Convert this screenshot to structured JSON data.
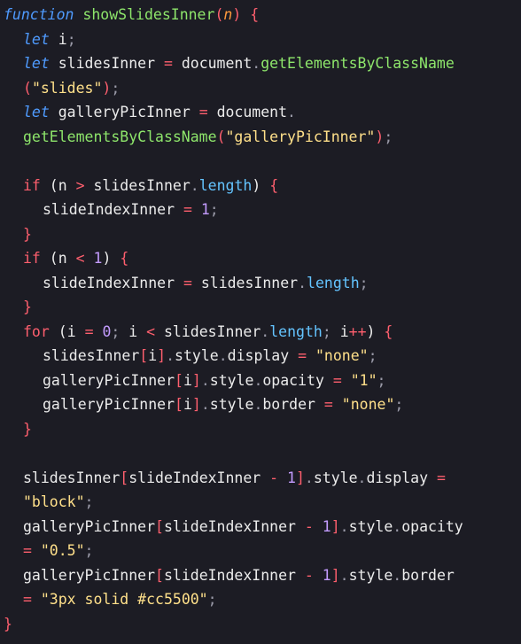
{
  "editor": {
    "lines": [
      {
        "indent": 0,
        "tokens": [
          {
            "t": "function",
            "c": "kw-italic"
          },
          {
            "t": " ",
            "c": "ident"
          },
          {
            "t": "showSlidesInner",
            "c": "fn"
          },
          {
            "t": "(",
            "c": "brace"
          },
          {
            "t": "n",
            "c": "param"
          },
          {
            "t": ")",
            "c": "brace"
          },
          {
            "t": " ",
            "c": "ident"
          },
          {
            "t": "{",
            "c": "brace"
          }
        ]
      },
      {
        "indent": 1,
        "tokens": [
          {
            "t": "let",
            "c": "kw-italic"
          },
          {
            "t": " i",
            "c": "ident"
          },
          {
            "t": ";",
            "c": "punc"
          }
        ]
      },
      {
        "indent": 1,
        "tokens": [
          {
            "t": "let",
            "c": "kw-italic"
          },
          {
            "t": " slidesInner ",
            "c": "ident"
          },
          {
            "t": "=",
            "c": "op"
          },
          {
            "t": " document",
            "c": "ident"
          },
          {
            "t": ".",
            "c": "punc"
          },
          {
            "t": "getElementsByClassName",
            "c": "fn"
          }
        ]
      },
      {
        "indent": 1,
        "tokens": [
          {
            "t": "(",
            "c": "brace"
          },
          {
            "t": "\"slides\"",
            "c": "str"
          },
          {
            "t": ")",
            "c": "brace"
          },
          {
            "t": ";",
            "c": "punc"
          }
        ]
      },
      {
        "indent": 1,
        "tokens": [
          {
            "t": "let",
            "c": "kw-italic"
          },
          {
            "t": " galleryPicInner ",
            "c": "ident"
          },
          {
            "t": "=",
            "c": "op"
          },
          {
            "t": " document",
            "c": "ident"
          },
          {
            "t": ".",
            "c": "punc"
          }
        ]
      },
      {
        "indent": 1,
        "tokens": [
          {
            "t": "getElementsByClassName",
            "c": "fn"
          },
          {
            "t": "(",
            "c": "brace"
          },
          {
            "t": "\"galleryPicInner\"",
            "c": "str"
          },
          {
            "t": ")",
            "c": "brace"
          },
          {
            "t": ";",
            "c": "punc"
          }
        ]
      },
      {
        "indent": 1,
        "tokens": []
      },
      {
        "indent": 1,
        "tokens": [
          {
            "t": "if",
            "c": "kw"
          },
          {
            "t": " (",
            "c": "ident"
          },
          {
            "t": "n ",
            "c": "ident"
          },
          {
            "t": ">",
            "c": "op"
          },
          {
            "t": " slidesInner",
            "c": "ident"
          },
          {
            "t": ".",
            "c": "punc"
          },
          {
            "t": "length",
            "c": "prop"
          },
          {
            "t": ") ",
            "c": "ident"
          },
          {
            "t": "{",
            "c": "brace"
          }
        ]
      },
      {
        "indent": 2,
        "tokens": [
          {
            "t": "slideIndexInner ",
            "c": "ident"
          },
          {
            "t": "=",
            "c": "op"
          },
          {
            "t": " ",
            "c": "ident"
          },
          {
            "t": "1",
            "c": "num"
          },
          {
            "t": ";",
            "c": "punc"
          }
        ]
      },
      {
        "indent": 1,
        "tokens": [
          {
            "t": "}",
            "c": "brace"
          }
        ]
      },
      {
        "indent": 1,
        "tokens": [
          {
            "t": "if",
            "c": "kw"
          },
          {
            "t": " (",
            "c": "ident"
          },
          {
            "t": "n ",
            "c": "ident"
          },
          {
            "t": "<",
            "c": "op"
          },
          {
            "t": " ",
            "c": "ident"
          },
          {
            "t": "1",
            "c": "num"
          },
          {
            "t": ") ",
            "c": "ident"
          },
          {
            "t": "{",
            "c": "brace"
          }
        ]
      },
      {
        "indent": 2,
        "tokens": [
          {
            "t": "slideIndexInner ",
            "c": "ident"
          },
          {
            "t": "=",
            "c": "op"
          },
          {
            "t": " slidesInner",
            "c": "ident"
          },
          {
            "t": ".",
            "c": "punc"
          },
          {
            "t": "length",
            "c": "prop"
          },
          {
            "t": ";",
            "c": "punc"
          }
        ]
      },
      {
        "indent": 1,
        "tokens": [
          {
            "t": "}",
            "c": "brace"
          }
        ]
      },
      {
        "indent": 1,
        "tokens": [
          {
            "t": "for",
            "c": "kw"
          },
          {
            "t": " (",
            "c": "ident"
          },
          {
            "t": "i ",
            "c": "ident"
          },
          {
            "t": "=",
            "c": "op"
          },
          {
            "t": " ",
            "c": "ident"
          },
          {
            "t": "0",
            "c": "num"
          },
          {
            "t": ";",
            "c": "punc"
          },
          {
            "t": " i ",
            "c": "ident"
          },
          {
            "t": "<",
            "c": "op"
          },
          {
            "t": " slidesInner",
            "c": "ident"
          },
          {
            "t": ".",
            "c": "punc"
          },
          {
            "t": "length",
            "c": "prop"
          },
          {
            "t": ";",
            "c": "punc"
          },
          {
            "t": " i",
            "c": "ident"
          },
          {
            "t": "++",
            "c": "op"
          },
          {
            "t": ") ",
            "c": "ident"
          },
          {
            "t": "{",
            "c": "brace"
          }
        ]
      },
      {
        "indent": 2,
        "tokens": [
          {
            "t": "slidesInner",
            "c": "ident"
          },
          {
            "t": "[",
            "c": "bracket"
          },
          {
            "t": "i",
            "c": "ident"
          },
          {
            "t": "]",
            "c": "bracket"
          },
          {
            "t": ".",
            "c": "punc"
          },
          {
            "t": "style",
            "c": "ident"
          },
          {
            "t": ".",
            "c": "punc"
          },
          {
            "t": "display ",
            "c": "ident"
          },
          {
            "t": "=",
            "c": "op"
          },
          {
            "t": " ",
            "c": "ident"
          },
          {
            "t": "\"none\"",
            "c": "str"
          },
          {
            "t": ";",
            "c": "punc"
          }
        ]
      },
      {
        "indent": 2,
        "tokens": [
          {
            "t": "galleryPicInner",
            "c": "ident"
          },
          {
            "t": "[",
            "c": "bracket"
          },
          {
            "t": "i",
            "c": "ident"
          },
          {
            "t": "]",
            "c": "bracket"
          },
          {
            "t": ".",
            "c": "punc"
          },
          {
            "t": "style",
            "c": "ident"
          },
          {
            "t": ".",
            "c": "punc"
          },
          {
            "t": "opacity ",
            "c": "ident"
          },
          {
            "t": "=",
            "c": "op"
          },
          {
            "t": " ",
            "c": "ident"
          },
          {
            "t": "\"1\"",
            "c": "str"
          },
          {
            "t": ";",
            "c": "punc"
          }
        ]
      },
      {
        "indent": 2,
        "tokens": [
          {
            "t": "galleryPicInner",
            "c": "ident"
          },
          {
            "t": "[",
            "c": "bracket"
          },
          {
            "t": "i",
            "c": "ident"
          },
          {
            "t": "]",
            "c": "bracket"
          },
          {
            "t": ".",
            "c": "punc"
          },
          {
            "t": "style",
            "c": "ident"
          },
          {
            "t": ".",
            "c": "punc"
          },
          {
            "t": "border ",
            "c": "ident"
          },
          {
            "t": "=",
            "c": "op"
          },
          {
            "t": " ",
            "c": "ident"
          },
          {
            "t": "\"none\"",
            "c": "str"
          },
          {
            "t": ";",
            "c": "punc"
          }
        ]
      },
      {
        "indent": 1,
        "tokens": [
          {
            "t": "}",
            "c": "brace"
          }
        ]
      },
      {
        "indent": 1,
        "tokens": []
      },
      {
        "indent": 1,
        "tokens": [
          {
            "t": "slidesInner",
            "c": "ident"
          },
          {
            "t": "[",
            "c": "bracket"
          },
          {
            "t": "slideIndexInner ",
            "c": "ident"
          },
          {
            "t": "-",
            "c": "op"
          },
          {
            "t": " ",
            "c": "ident"
          },
          {
            "t": "1",
            "c": "num"
          },
          {
            "t": "]",
            "c": "bracket"
          },
          {
            "t": ".",
            "c": "punc"
          },
          {
            "t": "style",
            "c": "ident"
          },
          {
            "t": ".",
            "c": "punc"
          },
          {
            "t": "display ",
            "c": "ident"
          },
          {
            "t": "=",
            "c": "op"
          }
        ]
      },
      {
        "indent": 1,
        "tokens": [
          {
            "t": "\"block\"",
            "c": "str"
          },
          {
            "t": ";",
            "c": "punc"
          }
        ]
      },
      {
        "indent": 1,
        "tokens": [
          {
            "t": "galleryPicInner",
            "c": "ident"
          },
          {
            "t": "[",
            "c": "bracket"
          },
          {
            "t": "slideIndexInner ",
            "c": "ident"
          },
          {
            "t": "-",
            "c": "op"
          },
          {
            "t": " ",
            "c": "ident"
          },
          {
            "t": "1",
            "c": "num"
          },
          {
            "t": "]",
            "c": "bracket"
          },
          {
            "t": ".",
            "c": "punc"
          },
          {
            "t": "style",
            "c": "ident"
          },
          {
            "t": ".",
            "c": "punc"
          },
          {
            "t": "opacity",
            "c": "ident"
          }
        ]
      },
      {
        "indent": 1,
        "tokens": [
          {
            "t": "=",
            "c": "op"
          },
          {
            "t": " ",
            "c": "ident"
          },
          {
            "t": "\"0.5\"",
            "c": "str"
          },
          {
            "t": ";",
            "c": "punc"
          }
        ]
      },
      {
        "indent": 1,
        "tokens": [
          {
            "t": "galleryPicInner",
            "c": "ident"
          },
          {
            "t": "[",
            "c": "bracket"
          },
          {
            "t": "slideIndexInner ",
            "c": "ident"
          },
          {
            "t": "-",
            "c": "op"
          },
          {
            "t": " ",
            "c": "ident"
          },
          {
            "t": "1",
            "c": "num"
          },
          {
            "t": "]",
            "c": "bracket"
          },
          {
            "t": ".",
            "c": "punc"
          },
          {
            "t": "style",
            "c": "ident"
          },
          {
            "t": ".",
            "c": "punc"
          },
          {
            "t": "border",
            "c": "ident"
          }
        ]
      },
      {
        "indent": 1,
        "tokens": [
          {
            "t": "=",
            "c": "op"
          },
          {
            "t": " ",
            "c": "ident"
          },
          {
            "t": "\"3px solid #cc5500\"",
            "c": "str"
          },
          {
            "t": ";",
            "c": "punc"
          }
        ]
      },
      {
        "indent": 0,
        "tokens": [
          {
            "t": "}",
            "c": "brace"
          }
        ]
      }
    ]
  }
}
